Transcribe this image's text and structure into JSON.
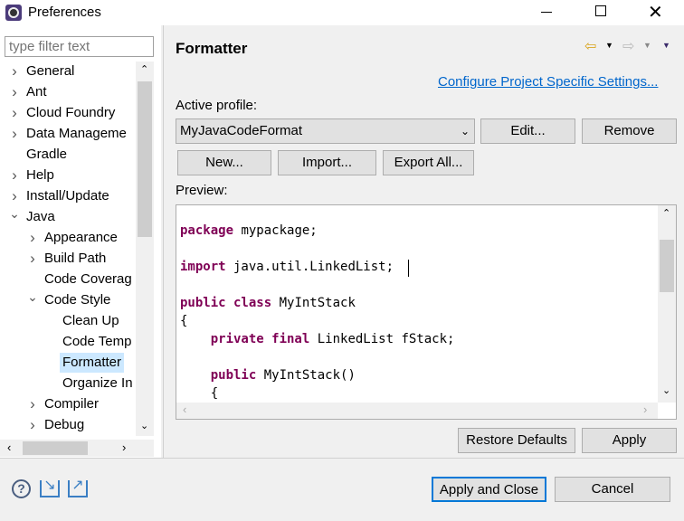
{
  "window": {
    "title": "Preferences"
  },
  "filter": {
    "placeholder": "type filter text"
  },
  "tree": [
    {
      "label": "General",
      "level": 1,
      "arrow": "collapsed"
    },
    {
      "label": "Ant",
      "level": 1,
      "arrow": "collapsed"
    },
    {
      "label": "Cloud Foundry",
      "level": 1,
      "arrow": "collapsed"
    },
    {
      "label": "Data Manageme",
      "level": 1,
      "arrow": "collapsed"
    },
    {
      "label": "Gradle",
      "level": 1,
      "arrow": "none"
    },
    {
      "label": "Help",
      "level": 1,
      "arrow": "collapsed"
    },
    {
      "label": "Install/Update",
      "level": 1,
      "arrow": "collapsed"
    },
    {
      "label": "Java",
      "level": 1,
      "arrow": "expanded"
    },
    {
      "label": "Appearance",
      "level": 2,
      "arrow": "collapsed"
    },
    {
      "label": "Build Path",
      "level": 2,
      "arrow": "collapsed"
    },
    {
      "label": "Code Coverag",
      "level": 2,
      "arrow": "none"
    },
    {
      "label": "Code Style",
      "level": 2,
      "arrow": "expanded"
    },
    {
      "label": "Clean Up",
      "level": 3,
      "arrow": "none"
    },
    {
      "label": "Code Temp",
      "level": 3,
      "arrow": "none"
    },
    {
      "label": "Formatter",
      "level": 3,
      "arrow": "none",
      "selected": true
    },
    {
      "label": "Organize In",
      "level": 3,
      "arrow": "none"
    },
    {
      "label": "Compiler",
      "level": 2,
      "arrow": "collapsed"
    },
    {
      "label": "Debug",
      "level": 2,
      "arrow": "collapsed"
    }
  ],
  "main": {
    "title": "Formatter",
    "config_link": "Configure Project Specific Settings...",
    "active_profile_label": "Active profile:",
    "profile_value": "MyJavaCodeFormat",
    "buttons": {
      "edit": "Edit...",
      "remove": "Remove",
      "new": "New...",
      "import": "Import...",
      "export_all": "Export All...",
      "restore": "Restore Defaults",
      "apply": "Apply"
    },
    "preview_label": "Preview:",
    "code": [
      {
        "kw": "package",
        "rest": " mypackage;"
      },
      {
        "kw": "import",
        "rest": " java.util.LinkedList;"
      },
      {
        "kw": "public class",
        "rest": " MyIntStack"
      },
      {
        "kw": "",
        "rest": "{"
      },
      {
        "kw": "    private final",
        "rest": " LinkedList fStack;"
      },
      {
        "kw": "    public",
        "rest": " MyIntStack()"
      },
      {
        "kw": "",
        "rest": "    {"
      }
    ]
  },
  "footer": {
    "apply_close": "Apply and Close",
    "cancel": "Cancel"
  },
  "colors": {
    "keyword": "#7f0055",
    "link": "#0066cc",
    "selection": "#cce8ff"
  }
}
